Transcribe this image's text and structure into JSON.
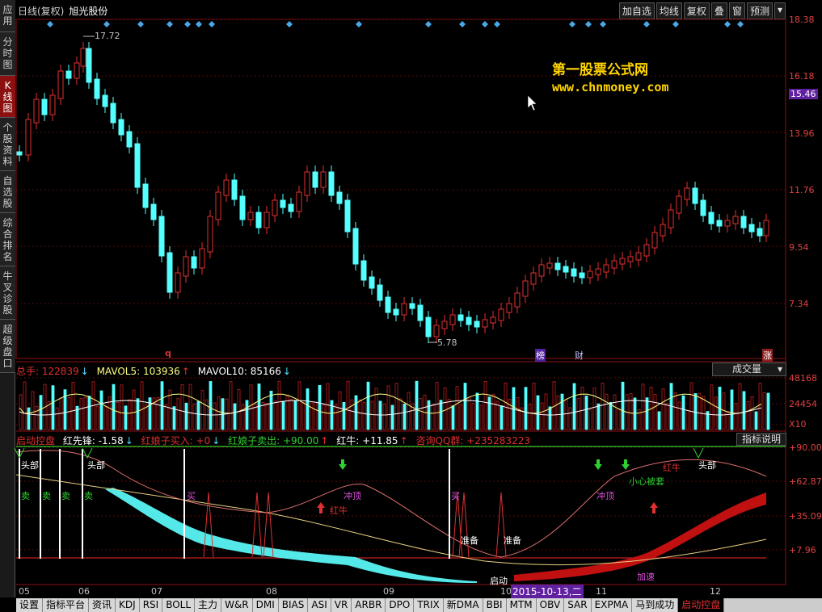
{
  "sidebar": {
    "tabs": [
      {
        "label": "应用",
        "active": false
      },
      {
        "label": "分时图",
        "active": false
      },
      {
        "label": "K线图",
        "active": true
      },
      {
        "label": "个股资料",
        "active": false
      },
      {
        "label": "自选股",
        "active": false
      },
      {
        "label": "综合排名",
        "active": false
      },
      {
        "label": "牛叉诊股",
        "active": false
      },
      {
        "label": "超级盘口",
        "active": false
      }
    ]
  },
  "topbar": {
    "mode": "日线(复权)",
    "stock_name": "旭光股份",
    "buttons": [
      "加自选",
      "均线",
      "复权",
      "叠",
      "窗",
      "预测"
    ]
  },
  "price_axis": [
    "18.38",
    "16.18",
    "15.46",
    "13.96",
    "11.76",
    "9.54",
    "7.34"
  ],
  "chart": {
    "high_label": "17.72",
    "low_label": "5.78",
    "markers": {
      "q": "q",
      "bang": "榜",
      "cai": "财",
      "zhang": "涨"
    }
  },
  "watermark": {
    "line1": "第一股票公式网",
    "line2": "www.chnmoney.com"
  },
  "volume": {
    "total": "总手: 122839",
    "mavol5": "MAVOL5: 103936",
    "mavol10": "MAVOL10: 85166",
    "selector": "成交量",
    "axis": [
      "48168",
      "24454",
      "X10"
    ]
  },
  "indicator": {
    "name": "启动控盘",
    "items": [
      {
        "label": "红先锋: -1.58",
        "color": "#ffffff"
      },
      {
        "label": "红娘子买入: +0",
        "color": "#e03030"
      },
      {
        "label": "红娘子卖出: +90.00",
        "color": "#30d030"
      },
      {
        "label": "红牛: +11.85",
        "color": "#ffffff"
      },
      {
        "label": "咨询QQ群: +235283223",
        "color": "#e03030"
      }
    ],
    "explain_button": "指标说明",
    "axis": [
      "+90.00",
      "+62.87",
      "+35.09",
      "+7.96"
    ],
    "annotations": {
      "head1": "头部",
      "head2": "头部",
      "head3": "头部",
      "sell": "卖",
      "buy": "买",
      "chongding1": "冲顶",
      "chongding2": "冲顶",
      "hongniu1": "红牛",
      "hongniu2": "红牛",
      "zhunbei1": "准备",
      "zhunbei2": "准备",
      "xiaoxin": "小心被套",
      "qidong": "启动",
      "jiasu": "加速"
    }
  },
  "dates": [
    "05",
    "06",
    "07",
    "08",
    "09",
    "10",
    "11",
    "12"
  ],
  "current_date": "2015-10-13,二",
  "bottom_tabs": [
    {
      "label": "设置",
      "active": false
    },
    {
      "label": "指标平台",
      "active": false
    },
    {
      "label": "资讯",
      "active": false
    },
    {
      "label": "KDJ",
      "active": false
    },
    {
      "label": "RSI",
      "active": false
    },
    {
      "label": "BOLL",
      "active": false
    },
    {
      "label": "主力",
      "active": false
    },
    {
      "label": "W&R",
      "active": false
    },
    {
      "label": "DMI",
      "active": false
    },
    {
      "label": "BIAS",
      "active": false
    },
    {
      "label": "ASI",
      "active": false
    },
    {
      "label": "VR",
      "active": false
    },
    {
      "label": "ARBR",
      "active": false
    },
    {
      "label": "DPO",
      "active": false
    },
    {
      "label": "TRIX",
      "active": false
    },
    {
      "label": "新DMA",
      "active": false
    },
    {
      "label": "BBI",
      "active": false
    },
    {
      "label": "MTM",
      "active": false
    },
    {
      "label": "OBV",
      "active": false
    },
    {
      "label": "SAR",
      "active": false
    },
    {
      "label": "EXPMA",
      "active": false
    },
    {
      "label": "马到成功",
      "active": false
    },
    {
      "label": "启动控盘",
      "active": true
    }
  ]
}
